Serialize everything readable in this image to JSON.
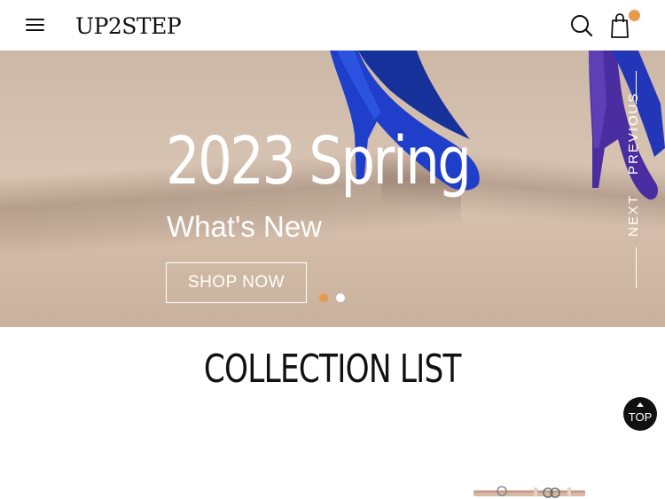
{
  "header": {
    "logo": "UP2STEP",
    "menu_icon": "hamburger-menu-icon",
    "search_icon": "search-icon",
    "cart_icon": "shopping-bag-icon",
    "cart_badge_color": "#e89a4c"
  },
  "hero": {
    "title": "2023 Spring",
    "subtitle": "What's New",
    "cta_label": "SHOP NOW",
    "previous_label": "PREVIOUS",
    "next_label": "NEXT",
    "slides_total": 2,
    "active_slide": 1,
    "active_dot_color": "#e89a4c"
  },
  "collection": {
    "title": "COLLECTION LIST"
  },
  "scroll_top": {
    "label": "TOP"
  }
}
